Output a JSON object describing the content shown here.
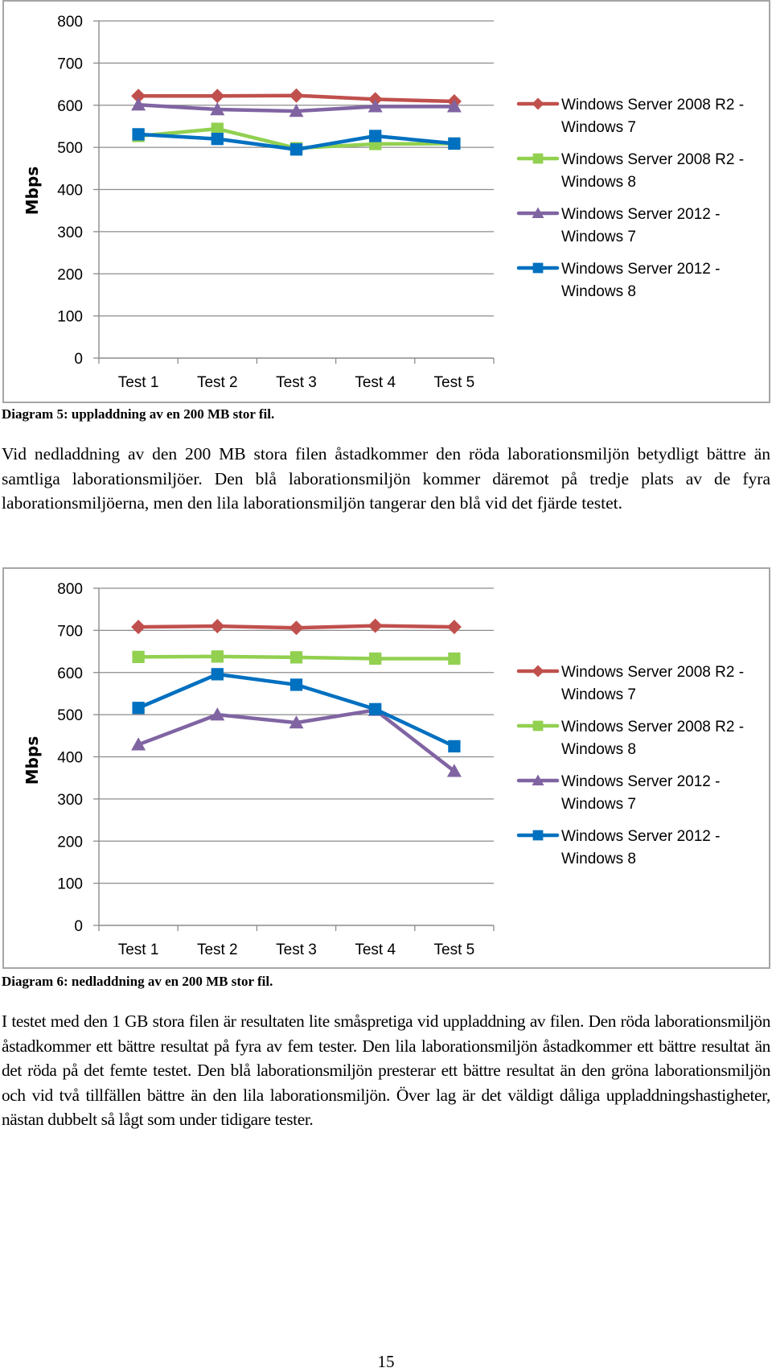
{
  "document": {
    "page_number": "15",
    "caption1": "Diagram 5: uppladdning av en 200 MB stor fil.",
    "paragraph1": "Vid nedladdning av den 200 MB stora filen åstadkommer den röda laborationsmiljön betydligt bättre än samtliga laborationsmiljöer. Den blå laborationsmiljön kommer däremot på tredje plats av de fyra laborationsmiljöerna, men den lila laborationsmiljön tangerar den blå vid det fjärde testet.",
    "caption2": "Diagram 6: nedladdning av en 200 MB stor fil.",
    "paragraph2": "I testet med den 1 GB stora filen är resultaten lite småspretiga vid uppladdning av filen. Den röda laborationsmiljön åstadkommer ett bättre resultat på fyra av fem tester. Den lila laborationsmiljön åstadkommer ett bättre resultat än det röda på det femte testet. Den blå laborationsmiljön presterar ett bättre resultat än den gröna laborationsmiljön och vid två tillfällen bättre än den lila laborationsmiljön. Över lag är det väldigt dåliga uppladdningshastigheter, nästan dubbelt så lågt som under tidigare tester."
  },
  "chart_data": [
    {
      "type": "line",
      "title": "",
      "caption": "Diagram 5: uppladdning av en 200 MB stor fil.",
      "xlabel": "",
      "ylabel": "Mbps",
      "ylim": [
        0,
        800
      ],
      "yticks": [
        0,
        100,
        200,
        300,
        400,
        500,
        600,
        700,
        800
      ],
      "ytick_labels": [
        "0",
        "100",
        "200",
        "300",
        "400",
        "500",
        "600",
        "700",
        "800"
      ],
      "grid": true,
      "legend_position": "right",
      "categories": [
        "Test 1",
        "Test 2",
        "Test 3",
        "Test 4",
        "Test 5"
      ],
      "series": [
        {
          "name": "Windows Server 2008 R2 - Windows 7",
          "legend_lines": [
            "Windows Server 2008 R2 -",
            "Windows 7"
          ],
          "color": "#C0504D",
          "marker": "diamond",
          "values": [
            622,
            622,
            623,
            614,
            609
          ]
        },
        {
          "name": "Windows Server 2008 R2 - Windows 8",
          "legend_lines": [
            "Windows Server 2008 R2 -",
            "Windows 8"
          ],
          "color": "#92D050",
          "marker": "square",
          "values": [
            527,
            544,
            498,
            508,
            509
          ]
        },
        {
          "name": "Windows Server 2012 - Windows 7",
          "legend_lines": [
            "Windows Server 2012 -",
            "Windows 7"
          ],
          "color": "#8064A2",
          "marker": "triangle",
          "values": [
            601,
            590,
            586,
            597,
            597
          ]
        },
        {
          "name": "Windows Server 2012 - Windows 8",
          "legend_lines": [
            "Windows Server 2012 -",
            "Windows 8"
          ],
          "color": "#0070C0",
          "marker": "square",
          "values": [
            531,
            520,
            495,
            527,
            509
          ]
        }
      ]
    },
    {
      "type": "line",
      "title": "",
      "caption": "Diagram 6: nedladdning av en 200 MB stor fil.",
      "xlabel": "",
      "ylabel": "Mbps",
      "ylim": [
        0,
        800
      ],
      "yticks": [
        0,
        100,
        200,
        300,
        400,
        500,
        600,
        700,
        800
      ],
      "ytick_labels": [
        "0",
        "100",
        "200",
        "300",
        "400",
        "500",
        "600",
        "700",
        "800"
      ],
      "grid": true,
      "legend_position": "right",
      "categories": [
        "Test 1",
        "Test 2",
        "Test 3",
        "Test 4",
        "Test 5"
      ],
      "series": [
        {
          "name": "Windows Server 2008 R2 - Windows 7",
          "legend_lines": [
            "Windows Server 2008 R2 -",
            "Windows 7"
          ],
          "color": "#C0504D",
          "marker": "diamond",
          "values": [
            708,
            710,
            706,
            711,
            708
          ]
        },
        {
          "name": "Windows Server 2008 R2 - Windows 8",
          "legend_lines": [
            "Windows Server 2008 R2 -",
            "Windows 8"
          ],
          "color": "#92D050",
          "marker": "square",
          "values": [
            637,
            638,
            636,
            633,
            633
          ]
        },
        {
          "name": "Windows Server 2012 - Windows 7",
          "legend_lines": [
            "Windows Server 2012 -",
            "Windows 7"
          ],
          "color": "#8064A2",
          "marker": "triangle",
          "values": [
            429,
            500,
            481,
            511,
            366
          ]
        },
        {
          "name": "Windows Server 2012 - Windows 8",
          "legend_lines": [
            "Windows Server 2012 -",
            "Windows 8"
          ],
          "color": "#0070C0",
          "marker": "square",
          "values": [
            516,
            596,
            571,
            513,
            425
          ]
        }
      ]
    }
  ]
}
